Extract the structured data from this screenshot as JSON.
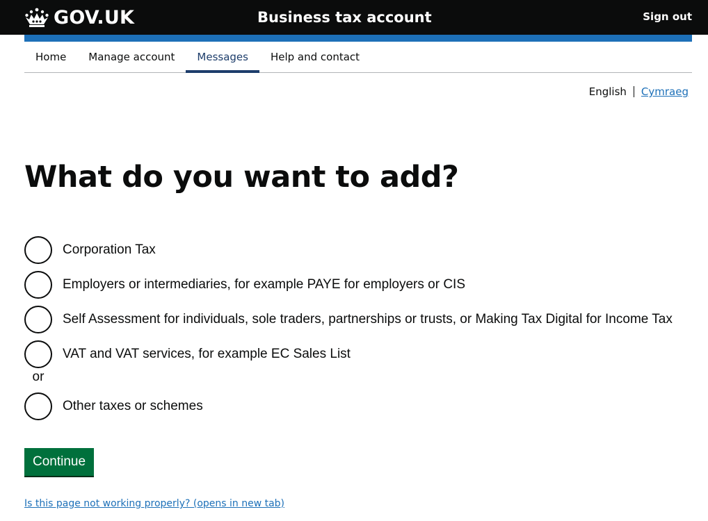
{
  "header": {
    "logo_text": "GOV.UK",
    "service_name": "Business tax account",
    "sign_out": "Sign out"
  },
  "nav": {
    "items": [
      {
        "label": "Home",
        "active": false
      },
      {
        "label": "Manage account",
        "active": false
      },
      {
        "label": "Messages",
        "active": true
      },
      {
        "label": "Help and contact",
        "active": false
      }
    ]
  },
  "language": {
    "current": "English",
    "alternative": "Cymraeg"
  },
  "page": {
    "heading": "What do you want to add?",
    "options": [
      "Corporation Tax",
      "Employers or intermediaries, for example PAYE for employers or CIS",
      "Self Assessment for individuals, sole traders, partnerships or trusts, or Making Tax Digital for Income Tax",
      "VAT and VAT services, for example EC Sales List"
    ],
    "divider": "or",
    "other_option": "Other taxes or schemes",
    "continue_label": "Continue",
    "help_link": "Is this page not working properly? (opens in new tab)"
  },
  "colors": {
    "header_bg": "#0b0c0c",
    "brand_blue": "#1d70b8",
    "nav_active": "#1d3d6b",
    "button_green": "#00703c"
  },
  "icons": {
    "logo": "crown-icon"
  }
}
